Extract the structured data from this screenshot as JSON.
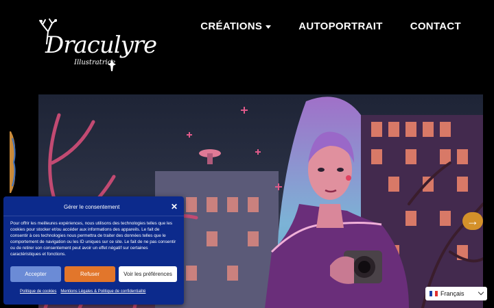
{
  "logo": {
    "title": "Draculyre",
    "subtitle": "Illustratrice"
  },
  "nav": {
    "creations": "CRÉATIONS",
    "autoportrait": "AUTOPORTRAIT",
    "contact": "CONTACT"
  },
  "consent": {
    "title": "Gérer le consentement",
    "close": "✕",
    "text": "Pour offrir les meilleures expériences, nous utilisons des technologies telles que les cookies pour stocker et/ou accéder aux informations des appareils. Le fait de consentir à ces technologies nous permettra de traiter des données telles que le comportement de navigation ou les ID uniques sur ce site. Le fait de ne pas consentir ou de retirer son consentement peut avoir un effet négatif sur certaines caractéristiques et fonctions.",
    "accept": "Accepter",
    "refuse": "Refuser",
    "preferences": "Voir les préférences",
    "link_cookies": "Politique de cookies",
    "link_legal": "Mentions Légales & Politique de confidentialité"
  },
  "language": {
    "selected": "Français"
  },
  "colors": {
    "consent_bg": "#0c2a8c",
    "accept": "#6b8bd6",
    "refuse": "#e2762b",
    "arrow": "#d4912a"
  },
  "icons": {
    "menu_caret": "caret-down-icon",
    "close": "close-icon",
    "next": "arrow-right-icon",
    "flag": "france-flag-icon",
    "select": "chevron-down-icon"
  }
}
